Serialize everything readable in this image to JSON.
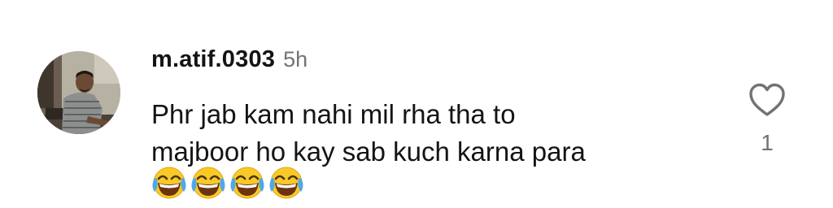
{
  "comment": {
    "username": "m.atif.0303",
    "timestamp": "5h",
    "text_lines": [
      "Phr jab kam nahi mil rha tha to",
      "majboor ho kay sab kuch karna para"
    ],
    "emoji": {
      "name": "face-with-tears-of-joy-icon",
      "count": 4
    },
    "like": {
      "icon": "heart-outline-icon",
      "count": "1"
    }
  }
}
